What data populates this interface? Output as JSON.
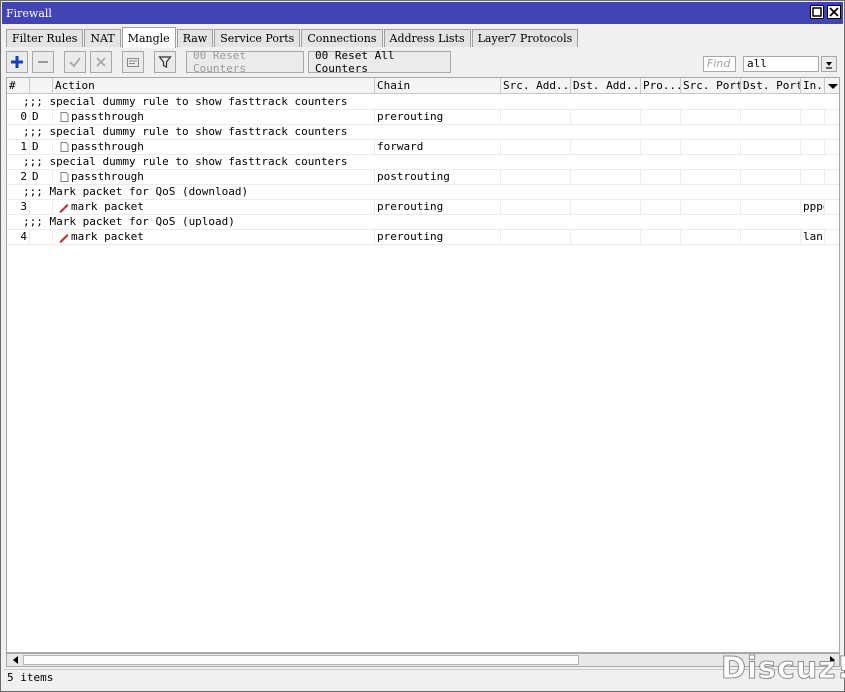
{
  "window": {
    "title": "Firewall"
  },
  "tabs": [
    "Filter Rules",
    "NAT",
    "Mangle",
    "Raw",
    "Service Ports",
    "Connections",
    "Address Lists",
    "Layer7 Protocols"
  ],
  "active_tab": "Mangle",
  "toolbar": {
    "reset_counters": "00 Reset Counters",
    "reset_all_counters": "00 Reset All Counters",
    "find_placeholder": "Find",
    "filter_value": "all"
  },
  "columns": [
    "#",
    "",
    "Action",
    "Chain",
    "Src. Add...",
    "Dst. Add...",
    "Pro...",
    "Src. Port",
    "Dst. Port",
    "In."
  ],
  "rows": [
    {
      "type": "comment",
      "text": ";;; special dummy rule to show fasttrack counters"
    },
    {
      "type": "rule",
      "num": "0",
      "flag": "D",
      "icon": "document-icon",
      "action": "passthrough",
      "chain": "prerouting",
      "in": ""
    },
    {
      "type": "comment",
      "text": ";;; special dummy rule to show fasttrack counters"
    },
    {
      "type": "rule",
      "num": "1",
      "flag": "D",
      "icon": "document-icon",
      "action": "passthrough",
      "chain": "forward",
      "in": ""
    },
    {
      "type": "comment",
      "text": ";;; special dummy rule to show fasttrack counters"
    },
    {
      "type": "rule",
      "num": "2",
      "flag": "D",
      "icon": "document-icon",
      "action": "passthrough",
      "chain": "postrouting",
      "in": ""
    },
    {
      "type": "comment",
      "text": ";;; Mark packet for QoS (download)"
    },
    {
      "type": "rule",
      "num": "3",
      "flag": "",
      "icon": "pencil-icon",
      "action": "mark packet",
      "chain": "prerouting",
      "in": "pppo..."
    },
    {
      "type": "comment",
      "text": ";;; Mark packet for QoS (upload)"
    },
    {
      "type": "rule",
      "num": "4",
      "flag": "",
      "icon": "pencil-icon",
      "action": "mark packet",
      "chain": "prerouting",
      "in": "lan"
    }
  ],
  "status": {
    "items": "5 items"
  },
  "watermark": "Discuz!"
}
